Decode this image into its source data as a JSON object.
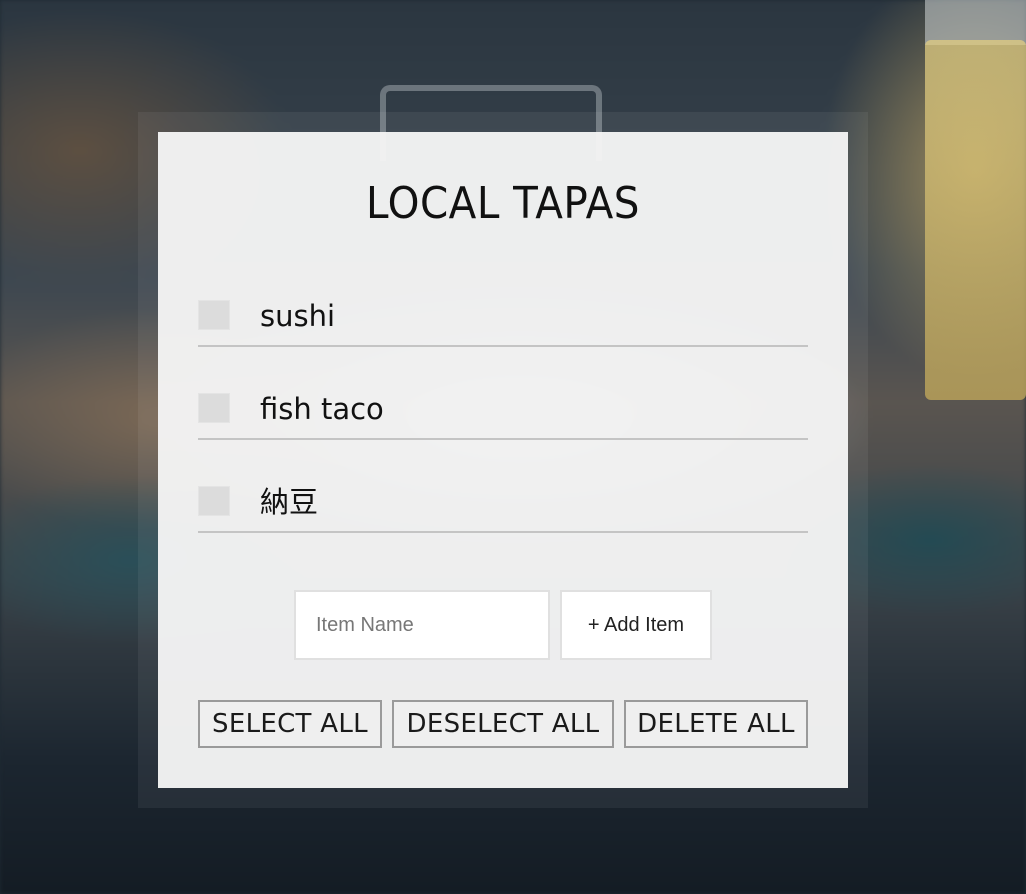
{
  "app": {
    "title": "LOCAL TAPAS"
  },
  "items": [
    {
      "label": "sushi",
      "checked": false
    },
    {
      "label": "fish taco",
      "checked": false
    },
    {
      "label": "納豆",
      "checked": false
    }
  ],
  "add_form": {
    "input_placeholder": "Item Name",
    "input_value": "",
    "add_button_label": "+ Add Item"
  },
  "actions": {
    "select_all_label": "SELECT ALL",
    "deselect_all_label": "DESELECT ALL",
    "delete_all_label": "DELETE ALL"
  },
  "colors": {
    "card_background": "#f5f5f5",
    "checkbox_fill": "#dcdcdc",
    "divider": "#c4c4c4",
    "text": "#111111"
  }
}
